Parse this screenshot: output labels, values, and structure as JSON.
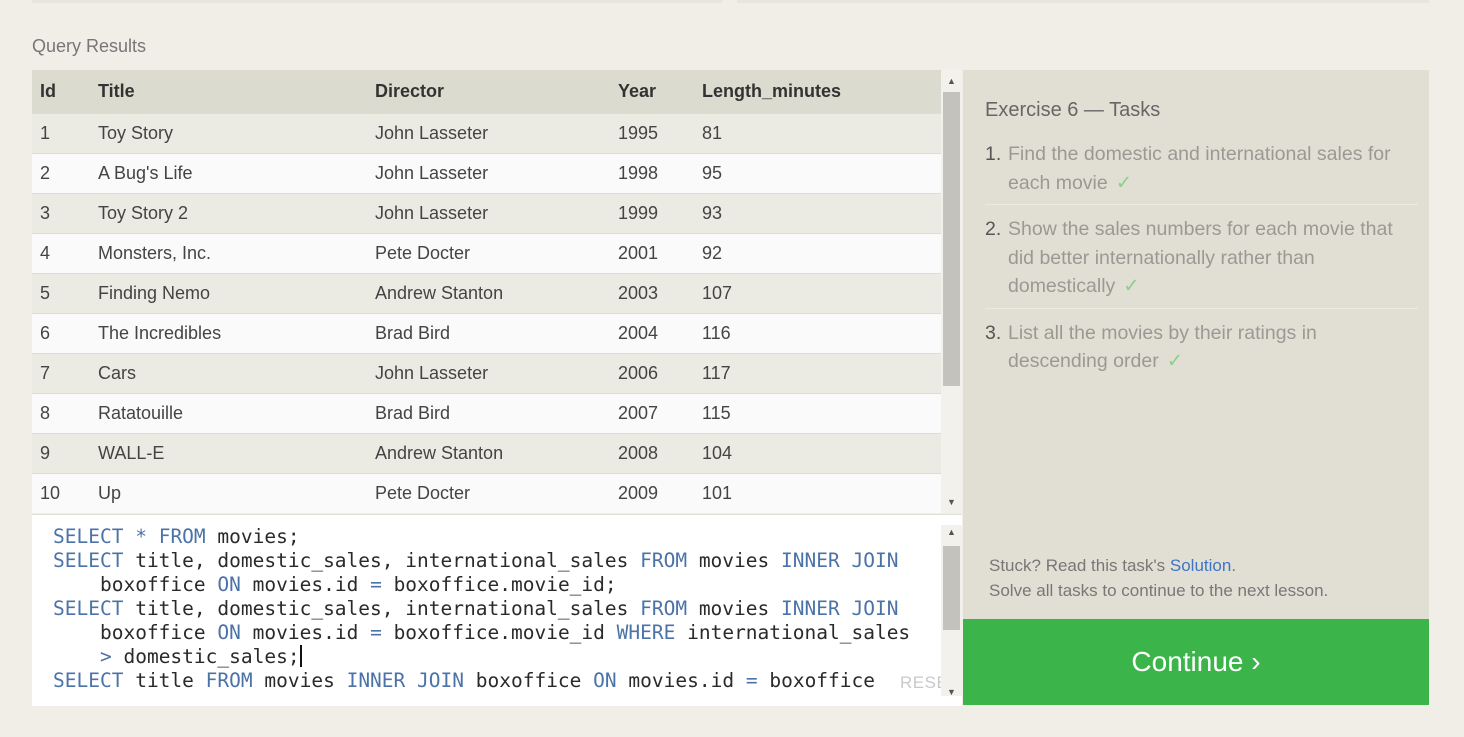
{
  "results": {
    "label": "Query Results",
    "columns": [
      "Id",
      "Title",
      "Director",
      "Year",
      "Length_minutes"
    ],
    "rows": [
      [
        "1",
        "Toy Story",
        "John Lasseter",
        "1995",
        "81"
      ],
      [
        "2",
        "A Bug's Life",
        "John Lasseter",
        "1998",
        "95"
      ],
      [
        "3",
        "Toy Story 2",
        "John Lasseter",
        "1999",
        "93"
      ],
      [
        "4",
        "Monsters, Inc.",
        "Pete Docter",
        "2001",
        "92"
      ],
      [
        "5",
        "Finding Nemo",
        "Andrew Stanton",
        "2003",
        "107"
      ],
      [
        "6",
        "The Incredibles",
        "Brad Bird",
        "2004",
        "116"
      ],
      [
        "7",
        "Cars",
        "John Lasseter",
        "2006",
        "117"
      ],
      [
        "8",
        "Ratatouille",
        "Brad Bird",
        "2007",
        "115"
      ],
      [
        "9",
        "WALL-E",
        "Andrew Stanton",
        "2008",
        "104"
      ],
      [
        "10",
        "Up",
        "Pete Docter",
        "2009",
        "101"
      ]
    ]
  },
  "editor": {
    "lines": [
      "SELECT * FROM movies;",
      "SELECT title, domestic_sales, international_sales FROM movies INNER JOIN",
      "    boxoffice ON movies.id = boxoffice.movie_id;",
      "SELECT title, domestic_sales, international_sales FROM movies INNER JOIN",
      "    boxoffice ON movies.id = boxoffice.movie_id WHERE international_sales",
      "    > domestic_sales;",
      "SELECT title FROM movies INNER JOIN boxoffice ON movies.id = boxoffice"
    ],
    "cursor_line": 5,
    "reset_label": "RESET"
  },
  "tasks": {
    "title": "Exercise 6 — Tasks",
    "items": [
      {
        "num": "1.",
        "text": "Find the domestic and international sales for each movie",
        "check": "✓"
      },
      {
        "num": "2.",
        "text": "Show the sales numbers for each movie that did better internationally rather than domestically",
        "check": "✓"
      },
      {
        "num": "3.",
        "text": "List all the movies by their ratings in descending order",
        "check": "✓"
      }
    ],
    "stuck_prefix": "Stuck? Read this task's ",
    "solution_link": "Solution",
    "stuck_suffix": ".",
    "solve_all": "Solve all tasks to continue to the next lesson."
  },
  "continue_label": "Continue ›",
  "colors": {
    "continue": "#3bb54a",
    "keyword": "#4b73a8",
    "link": "#3e74c7",
    "check": "#8cd08c"
  },
  "icons": {
    "scroll_up": "scroll-up-arrow-icon",
    "scroll_down": "scroll-down-arrow-icon",
    "check": "check-icon"
  }
}
